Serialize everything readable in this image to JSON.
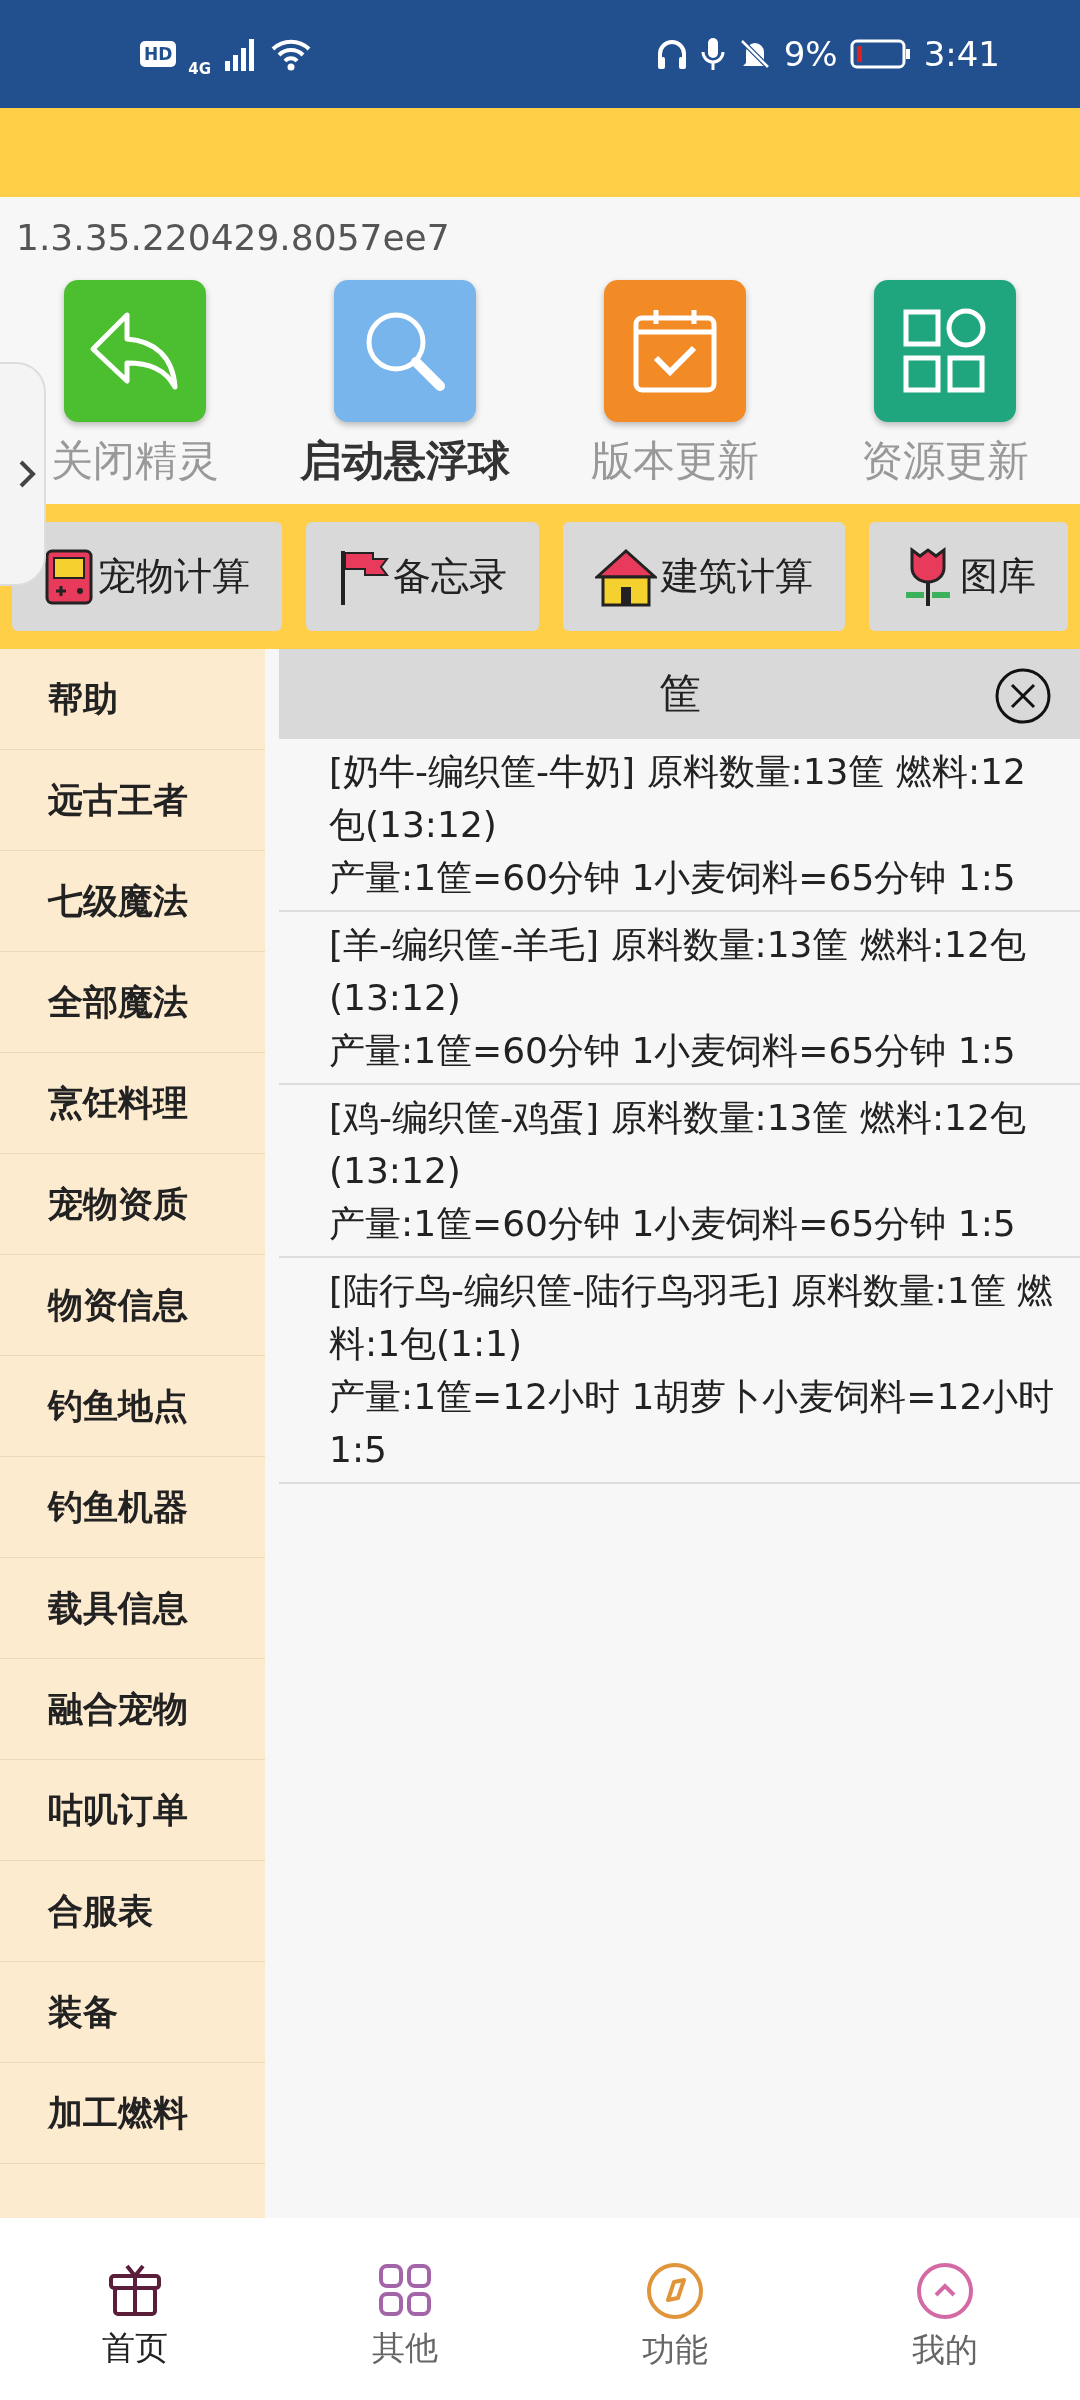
{
  "status_bar": {
    "hd_badge": "HD",
    "network": "4G",
    "battery": "9%",
    "time": "3:41"
  },
  "version": "1.3.35.220429.8057ee7",
  "launchers": [
    {
      "kind": "close",
      "label": "关闭精灵",
      "selected": false
    },
    {
      "kind": "search",
      "label": "启动悬浮球",
      "selected": true
    },
    {
      "kind": "calendar",
      "label": "版本更新",
      "selected": false
    },
    {
      "kind": "grid",
      "label": "资源更新",
      "selected": false
    }
  ],
  "tools": [
    {
      "kind": "gameboy",
      "label": "宠物计算"
    },
    {
      "kind": "flag",
      "label": "备忘录"
    },
    {
      "kind": "house",
      "label": "建筑计算"
    },
    {
      "kind": "flower",
      "label": "图库"
    }
  ],
  "sidebar": {
    "items": [
      {
        "label": "帮助"
      },
      {
        "label": "远古王者"
      },
      {
        "label": "七级魔法"
      },
      {
        "label": "全部魔法"
      },
      {
        "label": "烹饪料理"
      },
      {
        "label": "宠物资质"
      },
      {
        "label": "物资信息"
      },
      {
        "label": "钓鱼地点"
      },
      {
        "label": "钓鱼机器"
      },
      {
        "label": "载具信息"
      },
      {
        "label": "融合宠物"
      },
      {
        "label": "咕叽订单"
      },
      {
        "label": "合服表"
      },
      {
        "label": "装备"
      },
      {
        "label": "加工燃料"
      }
    ]
  },
  "panel": {
    "title": "筐",
    "entries": [
      {
        "recipe": "[奶牛-编织筐-牛奶] 原料数量:13筐 燃料:12包(13:12)",
        "output": "产量:1筐=60分钟 1小麦饲料=65分钟 1:5"
      },
      {
        "recipe": "[羊-编织筐-羊毛] 原料数量:13筐 燃料:12包(13:12)",
        "output": "产量:1筐=60分钟 1小麦饲料=65分钟 1:5"
      },
      {
        "recipe": "[鸡-编织筐-鸡蛋] 原料数量:13筐 燃料:12包(13:12)",
        "output": "产量:1筐=60分钟 1小麦饲料=65分钟 1:5"
      },
      {
        "recipe": "[陆行鸟-编织筐-陆行鸟羽毛] 原料数量:1筐 燃料:1包(1:1)",
        "output": "产量:1筐=12小时 1胡萝卜小麦饲料=12小时 1:5"
      }
    ]
  },
  "bottom_nav": [
    {
      "kind": "gift",
      "label": "首页",
      "selected": true
    },
    {
      "kind": "grid",
      "label": "其他",
      "selected": false
    },
    {
      "kind": "compass",
      "label": "功能",
      "selected": false
    },
    {
      "kind": "up",
      "label": "我的",
      "selected": false
    }
  ]
}
